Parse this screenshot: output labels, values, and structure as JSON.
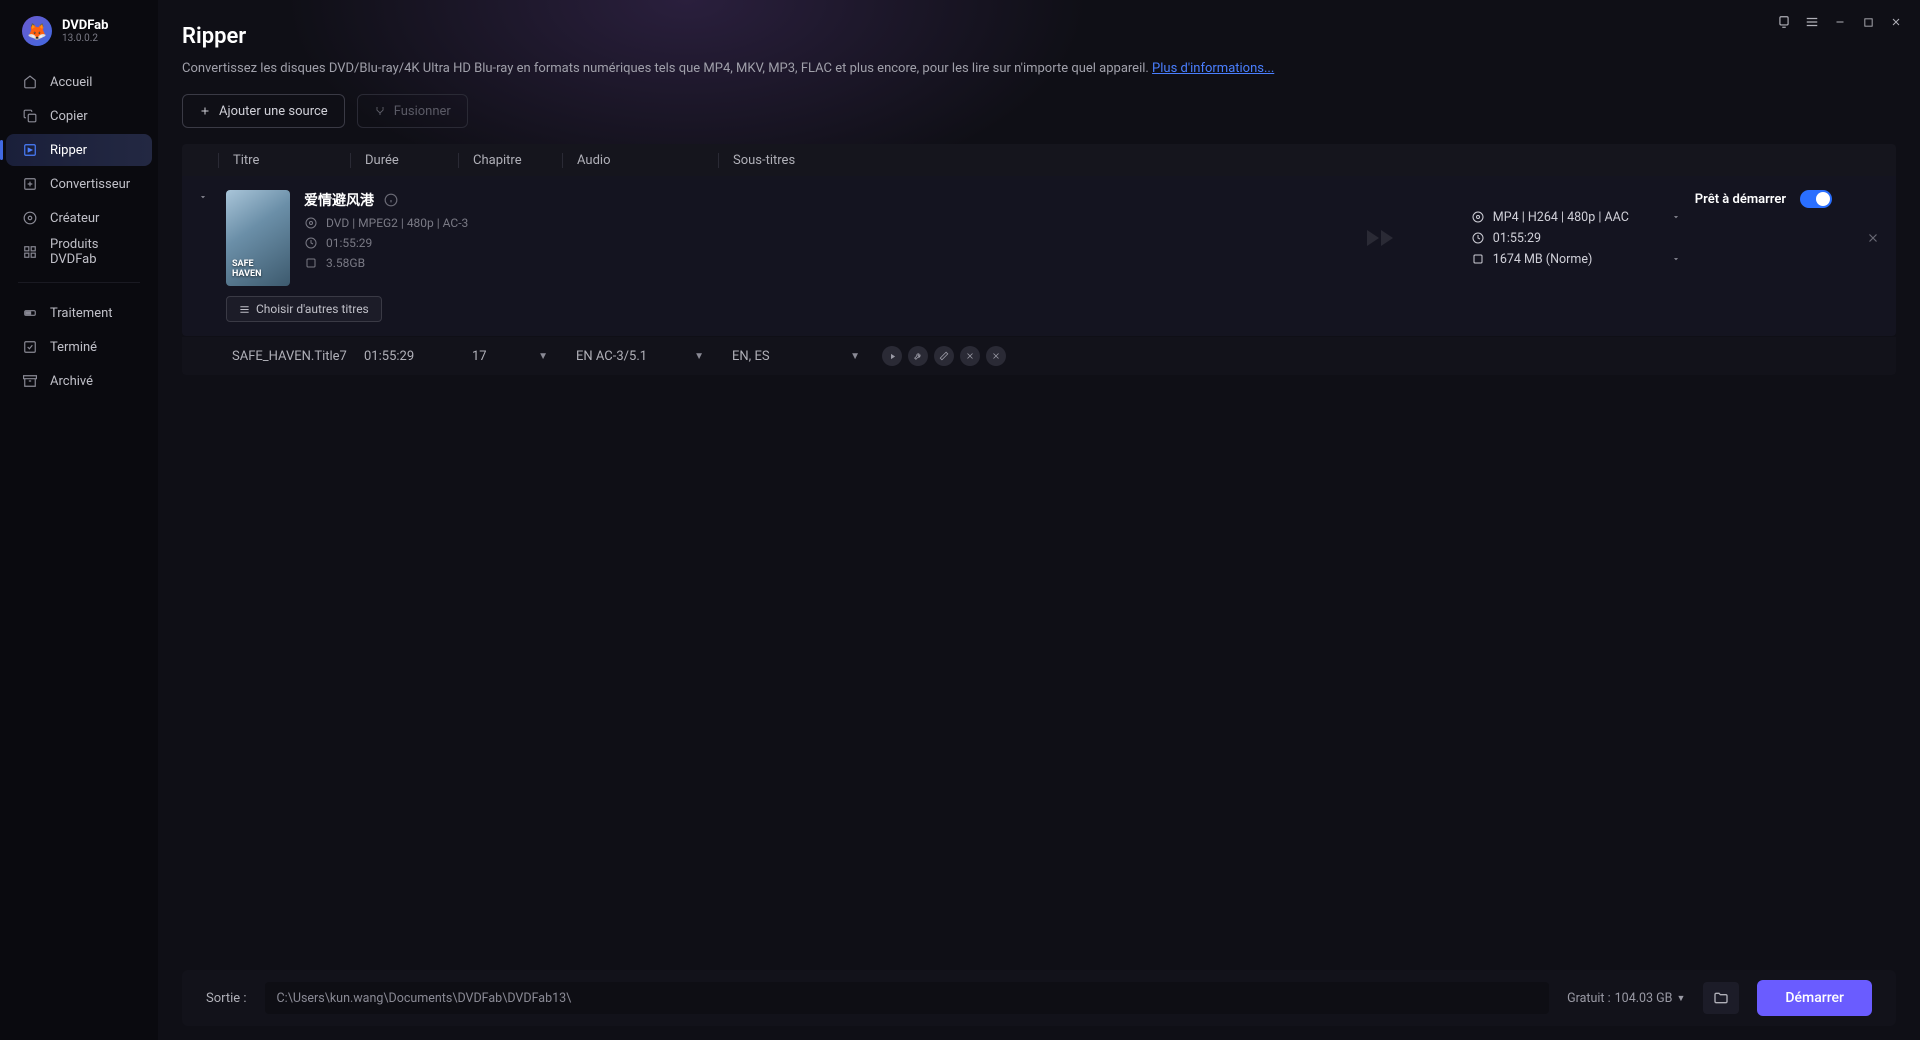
{
  "app": {
    "name": "DVDFab",
    "version": "13.0.0.2"
  },
  "sidebar": {
    "items": [
      {
        "label": "Accueil",
        "icon": "home"
      },
      {
        "label": "Copier",
        "icon": "copy"
      },
      {
        "label": "Ripper",
        "icon": "rip",
        "active": true
      },
      {
        "label": "Convertisseur",
        "icon": "convert"
      },
      {
        "label": "Créateur",
        "icon": "create"
      },
      {
        "label": "Produits DVDFab",
        "icon": "products"
      }
    ],
    "items2": [
      {
        "label": "Traitement",
        "icon": "progress"
      },
      {
        "label": "Terminé",
        "icon": "done"
      },
      {
        "label": "Archivé",
        "icon": "archive"
      }
    ]
  },
  "page": {
    "title": "Ripper",
    "desc": "Convertissez les disques DVD/Blu-ray/4K Ultra HD Blu-ray en formats numériques tels que MP4, MKV, MP3, FLAC et plus encore, pour les lire sur n'importe quel appareil. ",
    "more": "Plus d'informations...",
    "add_source": "Ajouter une source",
    "merge": "Fusionner"
  },
  "table": {
    "headers": {
      "titre": "Titre",
      "duree": "Durée",
      "chapitre": "Chapitre",
      "audio": "Audio",
      "sous": "Sous-titres"
    }
  },
  "task": {
    "title": "爱情避风港",
    "poster_label": "SAFE\nHAVEN",
    "src_format": "DVD | MPEG2 | 480p | AC-3",
    "src_duration": "01:55:29",
    "src_size": "3.58GB",
    "out_format": "MP4 | H264 | 480p | AAC",
    "out_duration": "01:55:29",
    "out_size": "1674 MB (Norme)",
    "status": "Prêt à démarrer",
    "choose_titles": "Choisir d'autres titres"
  },
  "title_row": {
    "name": "SAFE_HAVEN.Title7",
    "duration": "01:55:29",
    "chapters": "17",
    "audio": "EN  AC-3/5.1",
    "subs": "EN, ES"
  },
  "footer": {
    "label": "Sortie :",
    "path": "C:\\Users\\kun.wang\\Documents\\DVDFab\\DVDFab13\\",
    "free_label": "Gratuit : ",
    "free_value": "104.03 GB",
    "start": "Démarrer"
  }
}
